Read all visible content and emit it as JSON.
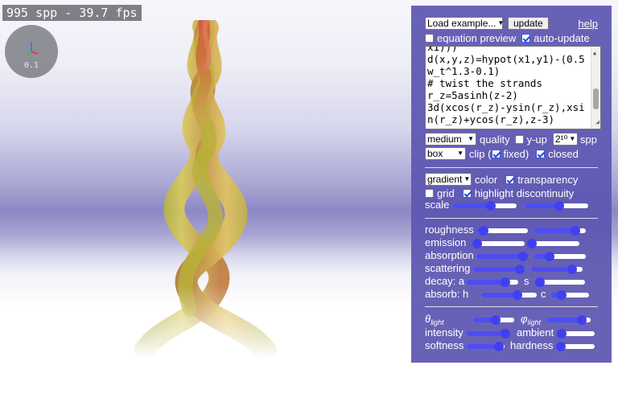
{
  "status": {
    "fps_text": "995 spp - 39.7 fps",
    "gizmo_scale": "0.1"
  },
  "header": {
    "example_select": "Load example...",
    "update_button": "update",
    "help_link": "help",
    "equation_preview_label": "equation preview",
    "equation_preview_checked": false,
    "auto_update_label": "auto-update",
    "auto_update_checked": true
  },
  "code": {
    "lines": [
      "x1)))",
      "d(x,y,z)=hypot(x1,y1)-(0.5",
      "w_t^1.3-0.1)",
      "# twist the strands",
      "r_z=5asinh(z-2)",
      "3d(xcos(r_z)-ysin(r_z),xsi",
      "n(r_z)+ycos(r_z),z-3)"
    ]
  },
  "render": {
    "quality_select": "medium",
    "quality_label": "quality",
    "y_up_label": "y-up",
    "y_up_checked": false,
    "spp_select": "2¹⁰",
    "spp_label": "spp",
    "clip_select": "box",
    "clip_label": "clip (",
    "fixed_label": "fixed)",
    "fixed_checked": true,
    "closed_label": "closed",
    "closed_checked": true
  },
  "color": {
    "color_select": "gradient",
    "color_label": "color",
    "transparency_label": "transparency",
    "transparency_checked": true,
    "grid_label": "grid",
    "grid_checked": false,
    "highlight_label": "highlight discontinuity",
    "highlight_checked": true,
    "scale_label": "scale",
    "scale_values": [
      0.6,
      0.55
    ]
  },
  "material": {
    "roughness_label": "roughness",
    "roughness_values": [
      0.15,
      0.8
    ],
    "emission_label": "emission",
    "emission_values": [
      0.0,
      0.05
    ],
    "absorption_label": "absorption",
    "absorption_values": [
      0.95,
      0.3
    ],
    "scattering_label": "scattering",
    "scattering_values": [
      0.9,
      0.8
    ],
    "decay_label": "decay: a",
    "decay_a_value": 0.75,
    "decay_s_label": "s",
    "decay_s_value": 0.05,
    "absorb_label": "absorb: h",
    "absorb_h_value": 0.65,
    "absorb_c_label": "c",
    "absorb_c_value": 0.3
  },
  "lighting": {
    "theta_symbol": "θ",
    "theta_sub": "light",
    "theta_value": 0.55,
    "phi_symbol": "φ",
    "phi_sub": "light",
    "phi_value": 0.8,
    "intensity_label": "intensity",
    "intensity_value": 0.95,
    "ambient_label": "ambient",
    "ambient_value": 0.05,
    "softness_label": "softness",
    "softness_value": 0.85,
    "hardness_label": "hardness",
    "hardness_value": 0.05
  },
  "colors": {
    "panel": "#5c56b0",
    "slider_fill": "#4040f0",
    "accent_check": "#1f4bd6"
  }
}
